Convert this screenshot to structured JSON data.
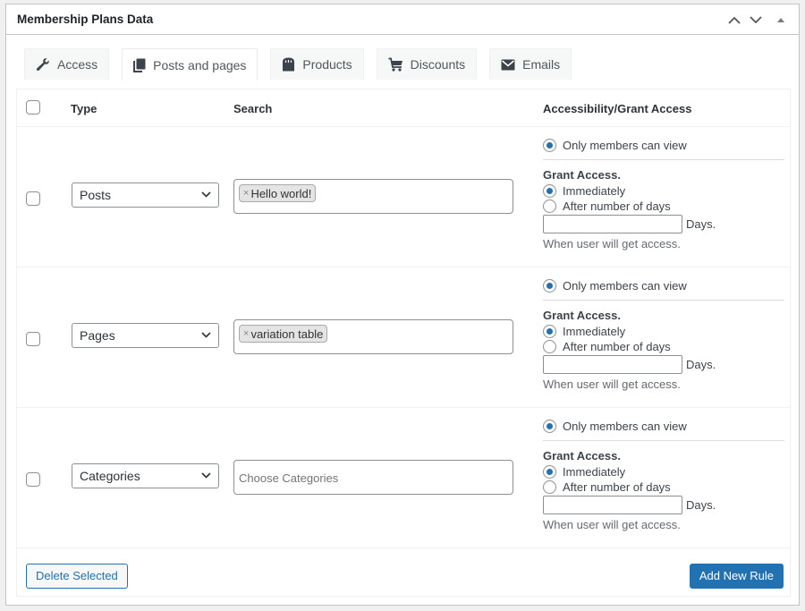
{
  "metabox": {
    "title": "Membership Plans Data",
    "controls": [
      "move-up",
      "move-down",
      "toggle-panel"
    ]
  },
  "tabs": [
    {
      "label": "Access",
      "icon": "wrench-icon",
      "active": false
    },
    {
      "label": "Posts and pages",
      "icon": "copy-pages-icon",
      "active": true
    },
    {
      "label": "Products",
      "icon": "shopping-bag-icon",
      "active": false
    },
    {
      "label": "Discounts",
      "icon": "cart-icon",
      "active": false
    },
    {
      "label": "Emails",
      "icon": "envelope-icon",
      "active": false
    }
  ],
  "table": {
    "headers": {
      "type": "Type",
      "search": "Search",
      "access": "Accessibility/Grant Access"
    },
    "rows": [
      {
        "checked": false,
        "type": "Posts",
        "search_tags": [
          "Hello world!"
        ],
        "search_placeholder": "",
        "view_option": "Only members can view",
        "grant_title": "Grant Access.",
        "grant_options": [
          "Immediately",
          "After number of days"
        ],
        "grant_selected": "Immediately",
        "days_value": "",
        "days_label": "Days.",
        "description": "When user will get access."
      },
      {
        "checked": false,
        "type": "Pages",
        "search_tags": [
          "variation table"
        ],
        "search_placeholder": "",
        "view_option": "Only members can view",
        "grant_title": "Grant Access.",
        "grant_options": [
          "Immediately",
          "After number of days"
        ],
        "grant_selected": "Immediately",
        "days_value": "",
        "days_label": "Days.",
        "description": "When user will get access."
      },
      {
        "checked": false,
        "type": "Categories",
        "search_tags": [],
        "search_placeholder": "Choose Categories",
        "view_option": "Only members can view",
        "grant_title": "Grant Access.",
        "grant_options": [
          "Immediately",
          "After number of days"
        ],
        "grant_selected": "Immediately",
        "days_value": "",
        "days_label": "Days.",
        "description": "When user will get access."
      }
    ]
  },
  "footer": {
    "delete_label": "Delete Selected",
    "add_label": "Add New Rule"
  },
  "colors": {
    "accent": "#2271b1",
    "border": "#c3c4c7",
    "tag_bg": "#e4e4e4"
  }
}
